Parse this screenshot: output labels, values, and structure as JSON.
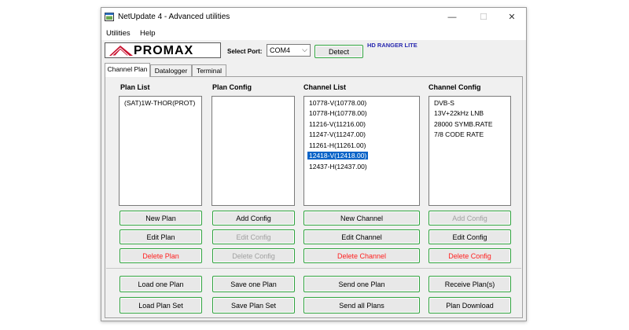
{
  "window": {
    "title": "NetUpdate 4 - Advanced utilities",
    "minimize": "—",
    "maximize": "☐",
    "close": "✕"
  },
  "menu": [
    {
      "label": "Utilities"
    },
    {
      "label": "Help"
    }
  ],
  "logo": {
    "text": "PROMAX",
    "brand_color": "#c8102e"
  },
  "port": {
    "label": "Select Port:",
    "value": "COM4",
    "detect": "Detect"
  },
  "device": "HD RANGER LITE",
  "tabs": [
    {
      "label": "Channel Plan",
      "active": true
    },
    {
      "label": "Datalogger"
    },
    {
      "label": "Terminal"
    }
  ],
  "columns": {
    "plan_list": {
      "header": "Plan List",
      "items": [
        "(SAT)1W-THOR(PROT)"
      ]
    },
    "plan_config": {
      "header": "Plan Config",
      "items": []
    },
    "channel_list": {
      "header": "Channel List",
      "items": [
        "10778-V(10778.00)",
        "10778-H(10778.00)",
        "11216-V(11216.00)",
        "11247-V(11247.00)",
        "11261-H(11261.00)",
        "12418-V(12418.00)",
        "12437-H(12437.00)"
      ],
      "selected_index": 5
    },
    "channel_config": {
      "header": "Channel Config",
      "items": [
        "DVB-S",
        "13V+22kHz LNB",
        "28000 SYMB.RATE",
        "7/8 CODE RATE"
      ]
    }
  },
  "buttons": {
    "new_plan": "New Plan",
    "edit_plan": "Edit Plan",
    "delete_plan": "Delete Plan",
    "add_config": "Add Config",
    "edit_config_plan": "Edit Config",
    "delete_config_plan": "Delete Config",
    "new_channel": "New Channel",
    "edit_channel": "Edit Channel",
    "delete_channel": "Delete Channel",
    "add_config_channel": "Add Config",
    "edit_config_channel": "Edit Config",
    "delete_config_channel": "Delete Config",
    "load_one_plan": "Load one Plan",
    "save_one_plan": "Save one Plan",
    "send_one_plan": "Send one Plan",
    "receive_plans": "Receive Plan(s)",
    "load_plan_set": "Load Plan Set",
    "save_plan_set": "Save Plan Set",
    "send_all_plans": "Send all Plans",
    "plan_download": "Plan Download"
  },
  "colors": {
    "button_border": "#2fa23e",
    "delete_text": "#ff2020",
    "disabled_text": "#a0a0a0",
    "selection": "#0a64c8",
    "device_label": "#2a2ab0"
  }
}
